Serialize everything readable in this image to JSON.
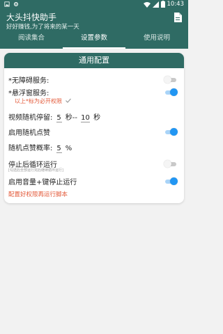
{
  "status_bar": {
    "time": "10:43"
  },
  "app": {
    "title": "大头抖快助手",
    "subtitle": "好好赚钱,为了将来的某一天"
  },
  "tabs": [
    "阅读集合",
    "设置参数",
    "使用说明"
  ],
  "card": {
    "title": "通用配置",
    "accessibility_label": "*无障碍服务:",
    "accessibility_on": false,
    "float_label": "*悬浮窗服务:",
    "float_on": true,
    "required_note": "以上*标为必开权限",
    "pause_label": "视频随机停留:",
    "pause_min": "5",
    "pause_sep": "秒--",
    "pause_max": "10",
    "pause_unit": "秒",
    "like_label": "启用随机点赞",
    "like_on": true,
    "like_rate_label": "随机点赞概率:",
    "like_rate_value": "5",
    "like_rate_unit": "%",
    "stop_loop_label": "停止后循环运行",
    "stop_loop_on": false,
    "stop_loop_hint": "[勾选后全部运行完后继续循环运行]",
    "volume_stop_label": "启用音量+键停止运行",
    "volume_stop_on": true,
    "config_tip": "配置好权限再运行脚本"
  },
  "colors": {
    "primary": "#2f6b64",
    "accent": "#2196f3",
    "warn": "#e35a3a"
  },
  "icons": {
    "status_left": [
      "image-icon",
      "settings-icon"
    ],
    "status_right": [
      "wifi-icon",
      "signal-icon",
      "battery-icon"
    ],
    "appbar": "document-icon"
  }
}
